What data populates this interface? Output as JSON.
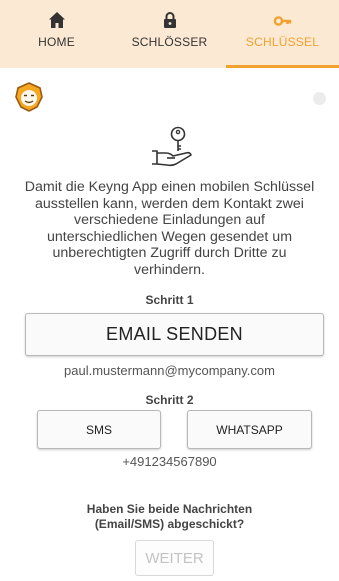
{
  "nav": {
    "tabs": [
      {
        "label": "HOME",
        "icon": "home-icon",
        "active": false
      },
      {
        "label": "SCHLÖSSER",
        "icon": "lock-icon",
        "active": false
      },
      {
        "label": "SCHLÜSSEL",
        "icon": "key-icon",
        "active": true
      }
    ]
  },
  "colors": {
    "accent": "#f0a12f",
    "nav_background": "#fbe9d4"
  },
  "header": {
    "logo_icon": "lion-logo-icon",
    "status_indicator_icon": "status-dot-icon"
  },
  "main": {
    "hero_icon": "hand-key-icon",
    "description": "Damit die Keyng App einen mobilen Schlüssel ausstellen kann, werden dem Kontakt zwei verschiedene Einladungen auf unterschiedlichen Wegen gesendet um unberechtigten Zugriff durch Dritte zu verhindern.",
    "step1": {
      "title": "Schritt 1",
      "button": "EMAIL SENDEN",
      "email": "paul.mustermann@mycompany.com"
    },
    "step2": {
      "title": "Schritt 2",
      "sms_button": "SMS",
      "whatsapp_button": "WHATSAPP",
      "phone": "+491234567890"
    },
    "question": "Haben Sie beide Nachrichten (Email/SMS) abgeschickt?",
    "continue_button": "WEITER"
  }
}
